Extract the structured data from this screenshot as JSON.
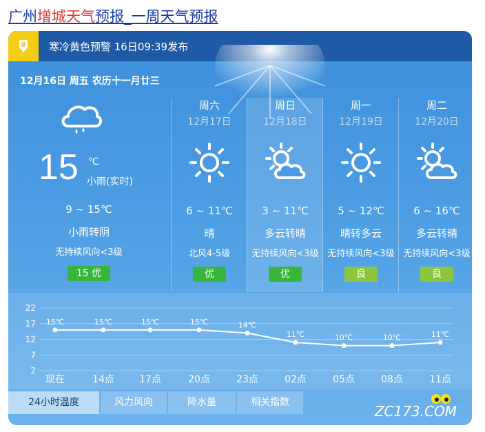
{
  "header": {
    "title_part1": "广州",
    "title_part2": "增城天气",
    "title_part3": "预报_一周天气预报"
  },
  "alert": {
    "icon": "cold-warning-icon",
    "text": "寒冷黄色预警 16日09:39发布",
    "icon_color": "#f5cc16"
  },
  "today": {
    "date_line": "12月16日 周五 农历十一月廿三",
    "icon": "light-rain-icon",
    "temp": "15",
    "unit": "℃",
    "desc": "小雨(实时)",
    "range": "9 ~ 15℃",
    "weather": "小雨转阴",
    "wind": "无持续风向<3级",
    "aqi": "15 优",
    "aqi_color": "#36b73c"
  },
  "days": [
    {
      "name": "周六",
      "date": "12月17日",
      "icon": "sunny-icon",
      "range": "6 ~ 11℃",
      "weather": "晴",
      "wind": "北风4-5级",
      "aqi": "优",
      "aqi_color": "#36b73c"
    },
    {
      "name": "周日",
      "date": "12月18日",
      "icon": "partly-cloudy-icon",
      "range": "3 ~ 11℃",
      "weather": "多云转晴",
      "wind": "无持续风向<3级",
      "aqi": "优",
      "aqi_color": "#36b73c"
    },
    {
      "name": "周一",
      "date": "12月19日",
      "icon": "sunny-icon",
      "range": "5 ~ 12℃",
      "weather": "晴转多云",
      "wind": "无持续风向<3级",
      "aqi": "良",
      "aqi_color": "#8cc63f"
    },
    {
      "name": "周二",
      "date": "12月20日",
      "icon": "partly-cloudy-icon",
      "range": "6 ~ 16℃",
      "weather": "多云转晴",
      "wind": "无持续风向<3级",
      "aqi": "良",
      "aqi_color": "#8cc63f"
    }
  ],
  "chart_data": {
    "type": "line",
    "categories": [
      "现在",
      "14点",
      "17点",
      "20点",
      "23点",
      "02点",
      "05点",
      "08点",
      "11点"
    ],
    "values": [
      15,
      15,
      15,
      15,
      14,
      11,
      10,
      10,
      11
    ],
    "point_labels": [
      "15℃",
      "15℃",
      "15℃",
      "15℃",
      "14℃",
      "11℃",
      "10℃",
      "10℃",
      "11℃"
    ],
    "y_ticks": [
      "22",
      "17",
      "12",
      "7",
      "2"
    ],
    "y_tick_values": [
      22,
      17,
      12,
      7,
      2
    ],
    "ylim": [
      2,
      22
    ],
    "grid": true
  },
  "tabs": [
    "24小时温度",
    "风力风向",
    "降水量",
    "相关指数"
  ],
  "watermark": "ZC173.COM"
}
